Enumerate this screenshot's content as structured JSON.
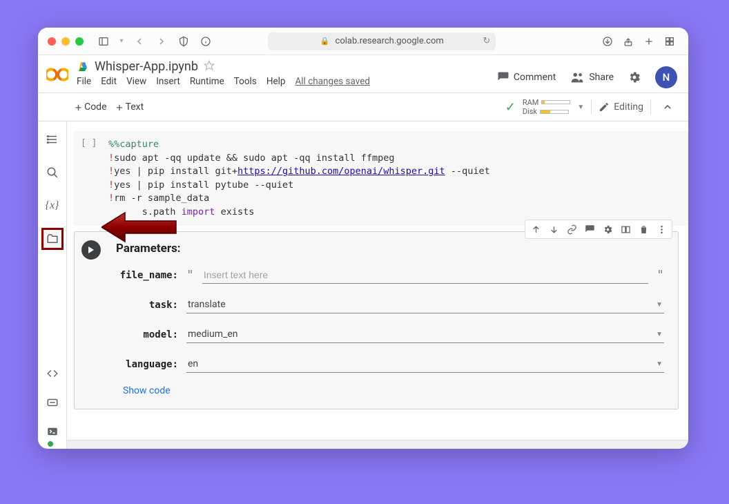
{
  "browser": {
    "url": "colab.research.google.com"
  },
  "header": {
    "filename": "Whisper-App.ipynb",
    "menu": [
      "File",
      "Edit",
      "View",
      "Insert",
      "Runtime",
      "Tools",
      "Help"
    ],
    "status_text": "All changes saved",
    "comment_label": "Comment",
    "share_label": "Share",
    "avatar_initial": "N"
  },
  "toolbar": {
    "code_label": "Code",
    "text_label": "Text",
    "ram_label": "RAM",
    "disk_label": "Disk",
    "editing_label": "Editing"
  },
  "cell1": {
    "gutter": "[ ]",
    "line1_magic": "%%capture",
    "line2_bang": "!",
    "line2_rest": "sudo apt -qq update && sudo apt -qq install ffmpeg",
    "line3_bang": "!",
    "line3_a": "yes | pip install git+",
    "line3_link": "https://github.com/openai/whisper.git",
    "line3_b": " --quiet",
    "line4_bang": "!",
    "line4_rest": "yes | pip install pytube --quiet",
    "line5_bang": "!",
    "line5_rest": "rm -r sample_data",
    "line6_a": "      s.path ",
    "line6_kw": "import",
    "line6_b": " exists"
  },
  "cell2": {
    "title": "Parameters:",
    "file_name_label": "file_name:",
    "file_name_placeholder": "Insert text here",
    "task_label": "task:",
    "task_value": "translate",
    "model_label": "model:",
    "model_value": "medium_en",
    "language_label": "language:",
    "language_value": "en",
    "show_code": "Show code"
  }
}
